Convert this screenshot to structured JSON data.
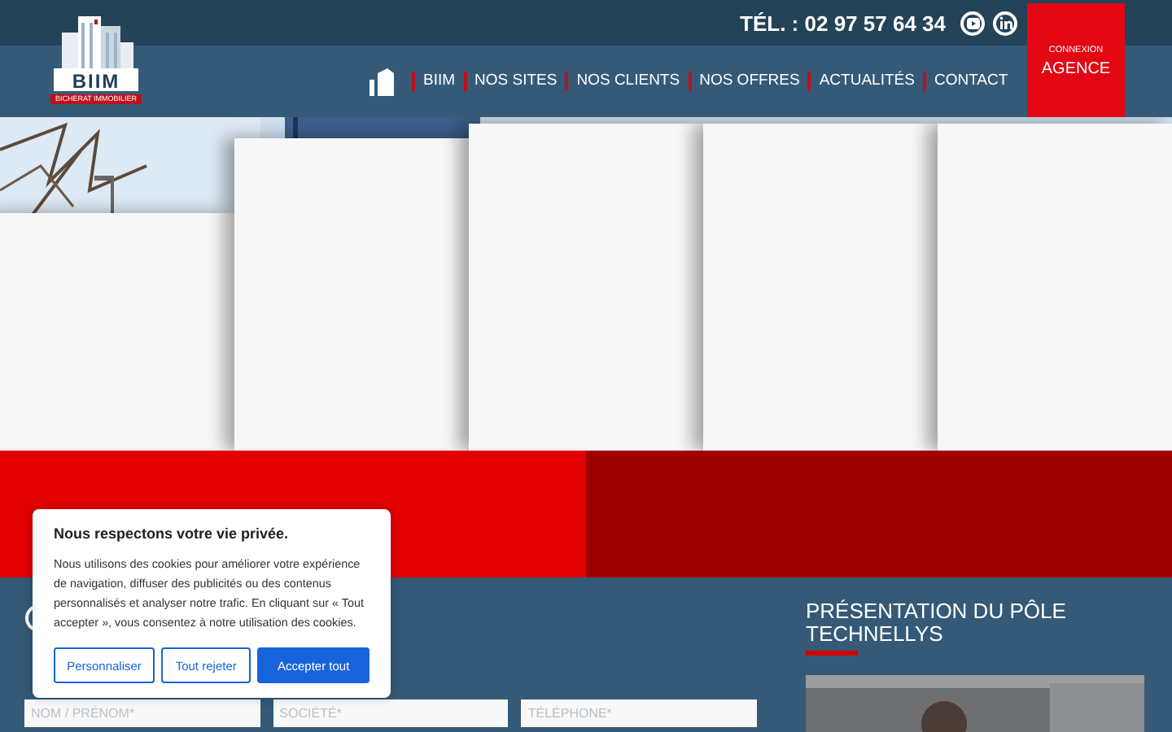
{
  "logo": {
    "name": "BIIM",
    "tagline": "BICHERAT IMMOBILIER"
  },
  "topbar": {
    "phone": "TÉL. : 02 97 57 64 34",
    "social": [
      {
        "kind": "youtube"
      },
      {
        "kind": "linkedin"
      }
    ]
  },
  "nav": {
    "items": [
      "BIIM",
      "NOS SITES",
      "NOS CLIENTS",
      "NOS OFFRES",
      "ACTUALITÉS",
      "CONTACT"
    ],
    "agency": {
      "caption": "CONNEXION",
      "label": "AGENCE"
    }
  },
  "cookie": {
    "title": "Nous respectons votre vie privée.",
    "text": "Nous utilisons des cookies pour améliorer votre expérience de navigation, diffuser des publicités ou des contenus personnalisés et analyser notre trafic. En cliquant sur « Tout accepter », vous consentez à notre utilisation des cookies.",
    "buttons": [
      {
        "label": "Personnaliser",
        "kind": "outline"
      },
      {
        "label": "Tout rejeter",
        "kind": "outline"
      },
      {
        "label": "Accepter tout",
        "kind": "primary"
      }
    ]
  },
  "form": {
    "fields": [
      {
        "placeholder": "NOM / PRÉNOM*"
      },
      {
        "placeholder": "SOCIÉTÉ*"
      },
      {
        "placeholder": "TÉLÉPHONE*"
      }
    ]
  },
  "aside": {
    "title": "PRÉSENTATION DU PÔLE TECHNELLYS"
  }
}
